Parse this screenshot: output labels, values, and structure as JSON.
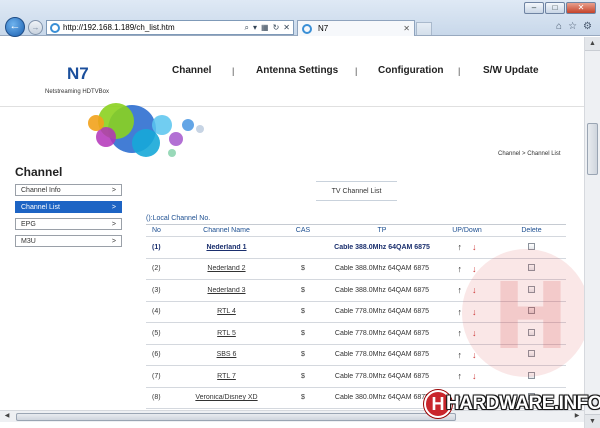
{
  "browser": {
    "url": "http://192.168.1.189/ch_list.htm",
    "tab_title": "N7",
    "window_buttons": [
      "–",
      "□",
      "✕"
    ]
  },
  "brand": {
    "name": "N7",
    "subtitle": "Netstreaming HDTVBox"
  },
  "top_nav": {
    "items": [
      "Channel",
      "Antenna Settings",
      "Configuration",
      "S/W Update"
    ],
    "separator": "|"
  },
  "breadcrumb": "Channel > Channel List",
  "sidebar": {
    "title": "Channel",
    "items": [
      {
        "label": "Channel Info",
        "arrow": ">"
      },
      {
        "label": "Channel List",
        "arrow": ">"
      },
      {
        "label": "EPG",
        "arrow": ">"
      },
      {
        "label": "M3U",
        "arrow": ">"
      }
    ],
    "active_index": 1
  },
  "main": {
    "section_tab": "TV Channel List",
    "local_note": "():Local Channel No.",
    "columns": [
      "No",
      "Channel Name",
      "CAS",
      "TP",
      "UP/Down",
      "Delete"
    ],
    "rows": [
      {
        "no": "(1)",
        "name": "Nederland 1",
        "cas": "",
        "tp": "Cable 388.0Mhz 64QAM 6875"
      },
      {
        "no": "(2)",
        "name": "Nederland 2",
        "cas": "$",
        "tp": "Cable 388.0Mhz 64QAM 6875"
      },
      {
        "no": "(3)",
        "name": "Nederland 3",
        "cas": "$",
        "tp": "Cable 388.0Mhz 64QAM 6875"
      },
      {
        "no": "(4)",
        "name": "RTL 4",
        "cas": "$",
        "tp": "Cable 778.0Mhz 64QAM 6875"
      },
      {
        "no": "(5)",
        "name": "RTL 5",
        "cas": "$",
        "tp": "Cable 778.0Mhz 64QAM 6875"
      },
      {
        "no": "(6)",
        "name": "SBS 6",
        "cas": "$",
        "tp": "Cable 778.0Mhz 64QAM 6875"
      },
      {
        "no": "(7)",
        "name": "RTL 7",
        "cas": "$",
        "tp": "Cable 778.0Mhz 64QAM 6875"
      },
      {
        "no": "(8)",
        "name": "Veronica/Disney XD",
        "cas": "$",
        "tp": "Cable 380.0Mhz 64QAM 6875"
      }
    ],
    "up_glyph": "↑",
    "down_glyph": "↓"
  },
  "watermark": {
    "logo_letter": "H",
    "logo_text": "HARDWARE.INFO"
  },
  "colors": {
    "brand": "#1b4f9c",
    "active": "#1d64c4",
    "down_arrow": "#cc3333",
    "watermark": "#c9262c"
  }
}
